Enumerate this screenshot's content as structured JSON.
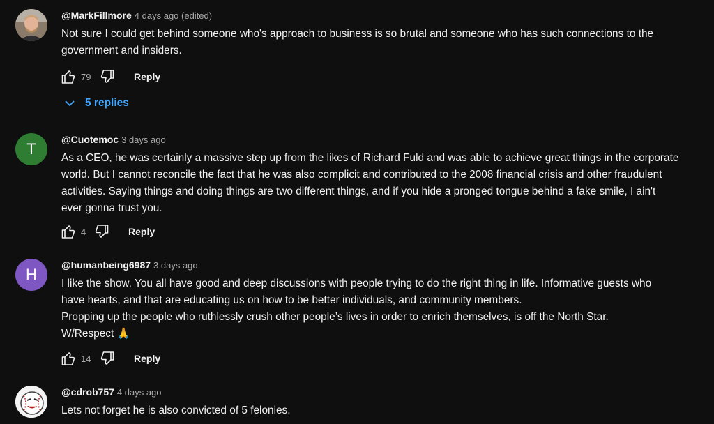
{
  "comments": [
    {
      "author": "@MarkFillmore",
      "time": "4 days ago (edited)",
      "lines": [
        "Not sure I could get behind someone who's approach to business is so brutal and someone who has such connections to the",
        "government and insiders."
      ],
      "likes": "79",
      "reply_label": "Reply",
      "replies_label": "5 replies",
      "avatar_icon": "person-photo-icon"
    },
    {
      "author": "@Cuotemoc",
      "time": "3 days ago",
      "avatar_letter": "T",
      "avatar_color": "#2e7d32",
      "lines": [
        "As a CEO, he was certainly a massive step up from the likes of Richard Fuld and was able to achieve great things in the corporate",
        "world. But I cannot reconcile the fact that he was also complicit and contributed to the 2008 financial crisis and other fraudulent",
        "activities. Saying things and doing things are two different things, and if you hide a pronged tongue behind a fake smile, I ain't",
        "ever gonna trust you."
      ],
      "likes": "4",
      "reply_label": "Reply"
    },
    {
      "author": "@humanbeing6987",
      "time": "3 days ago",
      "avatar_letter": "H",
      "avatar_color": "#7e57c2",
      "lines": [
        "I like the show. You all have good and deep discussions with people trying to do the right thing in life. Informative guests who",
        "have hearts, and that are educating us on how to be better individuals, and community members.",
        "Propping up the people who ruthlessly crush other people’s lives in order to enrich themselves, is off the North Star.",
        "W/Respect 🙏"
      ],
      "likes": "14",
      "reply_label": "Reply"
    },
    {
      "author": "@cdrob757",
      "time": "4 days ago",
      "lines": [
        "Lets not forget he is also convicted of 5 felonies."
      ],
      "avatar_icon": "baseball-avatar-icon"
    }
  ],
  "colors": {
    "background": "#0f0f0f",
    "link": "#3ea6ff",
    "muted": "#aaaaaa"
  }
}
